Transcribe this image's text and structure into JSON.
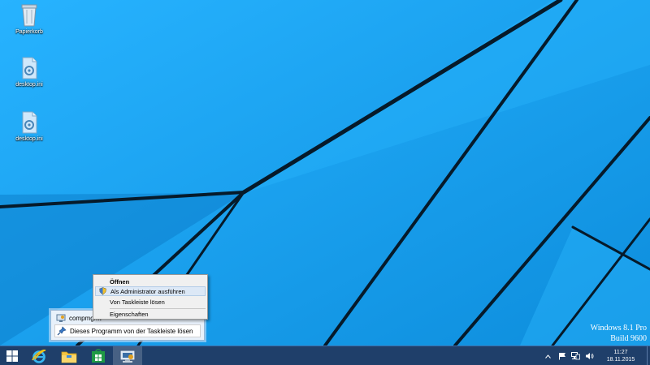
{
  "desktop": {
    "icons": [
      {
        "label": "Papierkorb",
        "icon": "recycle-bin-icon"
      },
      {
        "label": "desktop.ini",
        "icon": "settings-file-icon"
      },
      {
        "label": "desktop.ini",
        "icon": "settings-file-icon"
      }
    ],
    "watermark": {
      "line1": "Windows 8.1 Pro",
      "line2": "Build 9600"
    }
  },
  "jumplist": {
    "app_name": "compmgmt",
    "unpin_label": "Dieses Programm von der Taskleiste lösen"
  },
  "context_menu": {
    "items": [
      {
        "label": "Öffnen"
      },
      {
        "label": "Als Administrator ausführen"
      },
      {
        "label": "Von Taskleiste lösen"
      },
      {
        "label": "Eigenschaften"
      }
    ]
  },
  "taskbar": {
    "buttons": [
      {
        "icon": "start-icon"
      },
      {
        "icon": "internet-explorer-icon"
      },
      {
        "icon": "file-explorer-icon"
      },
      {
        "icon": "store-icon"
      },
      {
        "icon": "computer-management-icon"
      }
    ],
    "tray": {
      "time": "11:27",
      "date": "18.11.2015",
      "icons": [
        "show-hidden-icons-icon",
        "flag-icon",
        "network-icon",
        "volume-icon"
      ]
    }
  },
  "colors": {
    "taskbar": "#1f3f6a",
    "wallpaper": "#12a0f5",
    "menu_hover": "#dce8f6"
  }
}
